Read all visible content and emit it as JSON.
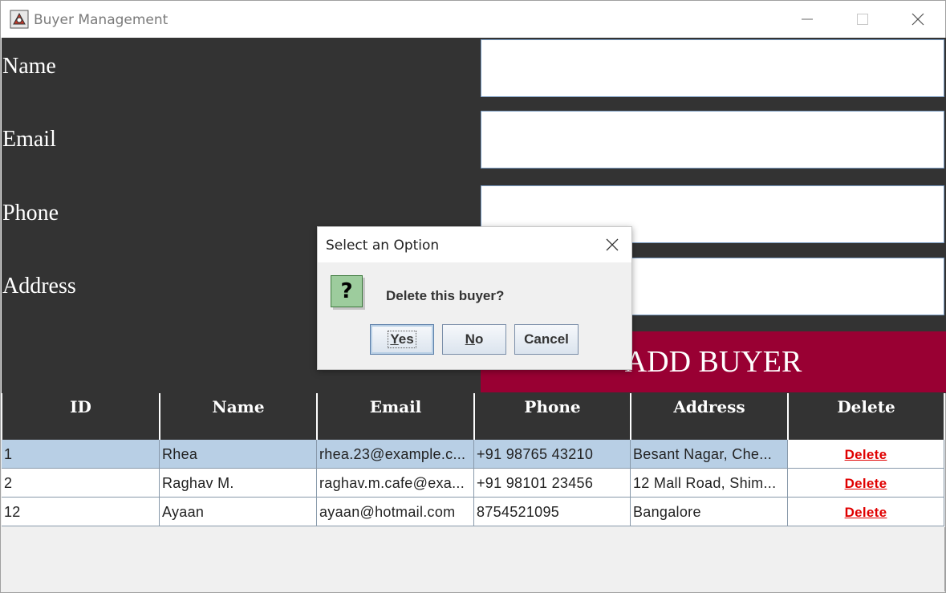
{
  "window": {
    "title": "Buyer Management"
  },
  "form": {
    "labels": {
      "name": "Name",
      "email": "Email",
      "phone": "Phone",
      "address": "Address"
    },
    "values": {
      "name": "",
      "email": "",
      "phone": "",
      "address": ""
    },
    "add_button": "ADD BUYER",
    "panel_color": "#333333",
    "accent_color": "#990033"
  },
  "table": {
    "headers": [
      "ID",
      "Name",
      "Email",
      "Phone",
      "Address",
      "Delete"
    ],
    "rows": [
      {
        "id": "1",
        "name": "Rhea",
        "email": "rhea.23@example.c...",
        "phone": "+91 98765 43210",
        "address": "Besant Nagar, Che...",
        "delete": "Delete",
        "selected": true
      },
      {
        "id": "2",
        "name": "Raghav M.",
        "email": "raghav.m.cafe@exa...",
        "phone": "+91 98101 23456",
        "address": "12 Mall Road, Shim...",
        "delete": "Delete",
        "selected": false
      },
      {
        "id": "12",
        "name": "Ayaan",
        "email": "ayaan@hotmail.com",
        "phone": "8754521095",
        "address": "Bangalore",
        "delete": "Delete",
        "selected": false
      }
    ]
  },
  "dialog": {
    "title": "Select an Option",
    "message": "Delete this buyer?",
    "icon": "question-icon",
    "buttons": {
      "yes_mnemonic": "Y",
      "yes_rest": "es",
      "no_mnemonic": "N",
      "no_rest": "o",
      "cancel": "Cancel"
    }
  }
}
